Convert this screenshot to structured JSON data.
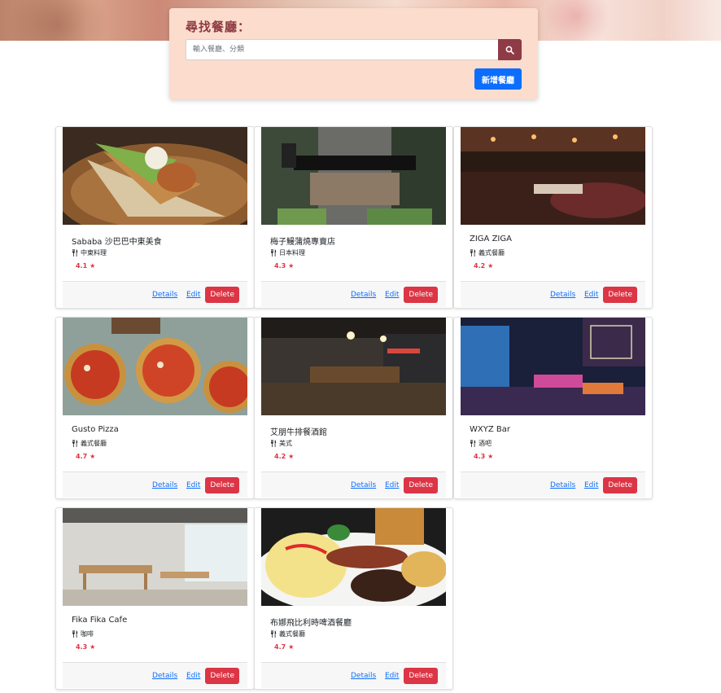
{
  "search": {
    "title": "尋找餐廳：",
    "placeholder": "輸入餐廳、分類",
    "add_button": "新增餐廳"
  },
  "restaurants": [
    {
      "name": "Sababa 沙巴巴中東美食",
      "category": "中東料理",
      "rating": "4.1"
    },
    {
      "name": "梅子鰻蒲燒專賣店",
      "category": "日本料理",
      "rating": "4.3"
    },
    {
      "name": "ZIGA ZIGA",
      "category": "義式餐廳",
      "rating": "4.2"
    },
    {
      "name": "Gusto Pizza",
      "category": "義式餐廳",
      "rating": "4.7"
    },
    {
      "name": "艾朋牛排餐酒館",
      "category": "美式",
      "rating": "4.2"
    },
    {
      "name": "WXYZ Bar",
      "category": "酒吧",
      "rating": "4.3"
    },
    {
      "name": "Fika Fika Cafe",
      "category": "咖啡",
      "rating": "4.3"
    },
    {
      "name": "布娜飛比利時啤酒餐廳",
      "category": "義式餐廳",
      "rating": "4.7"
    }
  ],
  "card_actions": {
    "details": "Details",
    "edit": "Edit",
    "delete": "Delete"
  },
  "colors": {
    "accent": "#8e3b46",
    "primary": "#0d6efd",
    "danger": "#dc3545",
    "panel": "#fbdccd"
  }
}
